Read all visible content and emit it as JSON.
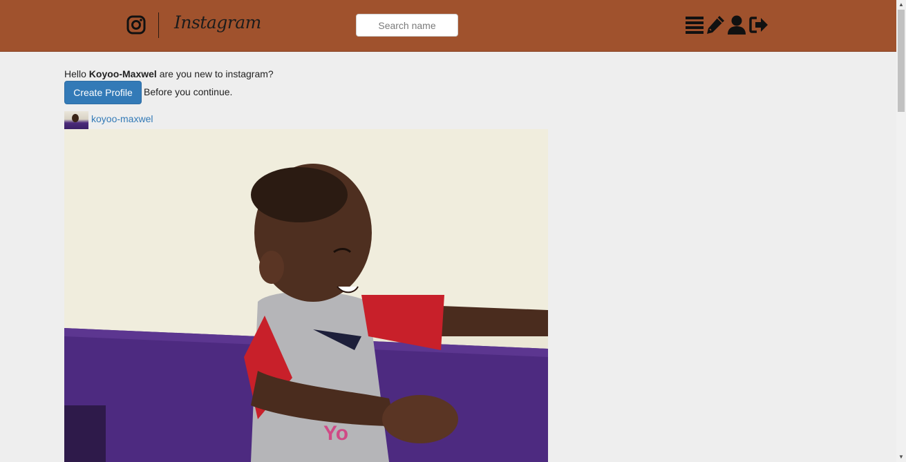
{
  "header": {
    "brand_text": "Instagram",
    "search_placeholder": "Search name",
    "icons": [
      "menu-icon",
      "edit-icon",
      "profile-icon",
      "logout-icon"
    ],
    "color": "#a0522d"
  },
  "main": {
    "greeting_prefix": "Hello",
    "username": "Koyoo-Maxwel",
    "greeting_suffix": "are you new to instagram?",
    "create_profile_label": "Create Profile",
    "continue_text": "Before you continue.",
    "button_color": "#337ab7"
  },
  "post": {
    "username": "koyoo-maxwel"
  }
}
